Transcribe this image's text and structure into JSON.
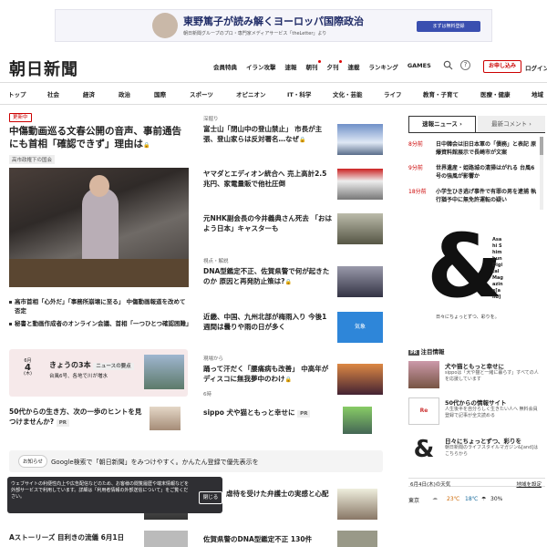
{
  "ad_top": {
    "title": "東野篤子が読み解くヨーロッパ国際政治",
    "sub": "朝日新聞グループのプロ・専門家メディアサービス「theLetter」より",
    "button": "まずは無料登録"
  },
  "header": {
    "logo": "朝日新聞",
    "nav": [
      "会員特典",
      "イラン攻撃",
      "速報",
      "朝刊",
      "夕刊",
      "連載",
      "ランキング",
      "GAMES"
    ],
    "search_icon": "search-icon",
    "help_icon": "help-icon",
    "subscribe": "お申し込み",
    "login": "ログイン"
  },
  "categories": [
    "トップ",
    "社会",
    "経済",
    "政治",
    "国際",
    "スポーツ",
    "オピニオン",
    "IT・科学",
    "文化・芸能",
    "ライフ",
    "教育・子育て",
    "医療・健康",
    "地域"
  ],
  "lead": {
    "badge": "更新中",
    "title": "中傷動画巡る文春公開の音声、事前通告にも首相「確認できず」理由は",
    "tag": "高市政権下の国会",
    "bullets": [
      "高市首相「心外だ」「事務所崩壊に至る」 中傷動画報道を改めて否定",
      "秘書と動画作成者のオンライン会議、首相「一つひとつ確認困難」"
    ]
  },
  "mid_articles": [
    {
      "label": "深掘り",
      "title": "富士山「閉山中の登山禁止」 市長が主張、登山家らは反対署名…なぜ"
    },
    {
      "label": "",
      "title": "ヤマダとエディオン統合へ 売上高計2.5兆円、家電量販で他社圧倒"
    },
    {
      "label": "",
      "title": "元NHK副会長の今井義典さん死去 「おはよう日本」キャスターも"
    },
    {
      "label": "視点・解説",
      "title": "DNA型鑑定不正、佐賀県警で何が起きたのか 原因と再発防止策は?"
    },
    {
      "label": "",
      "title": "近畿、中国、九州北部が梅雨入り 今後1週間は曇りや雨の日が多く"
    },
    {
      "label": "現場から",
      "title": "踊って汗だく「腰痛病も改善」 中高年がディスコに無我夢中のわけ"
    },
    {
      "label": "",
      "title": "sippo 犬や猫ともっと幸せに"
    }
  ],
  "mid_meta": {
    "weather_thumb": "気象",
    "video_count": "PR",
    "hours": "6時"
  },
  "box3": {
    "month": "6月",
    "day": "4",
    "weekday": "(木)",
    "title": "きょうの3本",
    "badge": "ニュースの要点",
    "sub": "台風6号、各地で川が増水"
  },
  "life_item": {
    "title": "50代からの生き方、次の一歩のヒントを見つけませんか?",
    "pr": "PR"
  },
  "notice": {
    "label": "お知らせ",
    "message": "Google検索で「朝日新聞」をみつけやすく。かんたん登録で優先表示を"
  },
  "cookie": {
    "text": "ウェブサイトの利便性向上や広告配信などのため、お客様の閲覧履歴や端末情報などを外部サービスで利用しています。詳細は「利用者情報の外部送信について」をご覧ください。",
    "close": "閉じる"
  },
  "bottom": [
    {
      "title": "Aストーリーズ 目利きの流儀 6月1日"
    },
    {
      "title": "佐賀県警のDNA型鑑定不正 130件"
    },
    {
      "title": "虐待を受けた弁護士の実感と心配"
    }
  ],
  "sidebar": {
    "tab_active": "速報ニュース",
    "tab_inactive": "最新コメント",
    "news": [
      {
        "time": "8分前",
        "text": "日中韓会は旧日本軍の「債務」と表記 原爆資料館展示で長崎市が文案"
      },
      {
        "time": "9分前",
        "text": "世界遺産・姫路城の清掃はがれる 台風6号の強風が影響か"
      },
      {
        "time": "18分前",
        "text": "小学生ひき逃げ事件で有罪の男を逮捕 執行猶予中に無免許運転の疑い"
      }
    ],
    "amp_ad": {
      "brand": "Asahi Shimbun Digital Magazine[and]",
      "tagline": "日々にちょっとずつ、彩りを。"
    },
    "promo_header": "注目情報",
    "promos": [
      {
        "title": "犬や猫ともっと幸せに",
        "desc": "sippoは「犬や猫と一緒に暮らす」すべての人を応援しています"
      },
      {
        "title": "50代からの情報サイト",
        "desc": "人生後半を自分らしく生きたい人へ 無料会員登録で記事が全文読める"
      },
      {
        "title": "日々にちょっとずつ、彩りを",
        "desc": "朝日新聞のライフスタイルマガジン&[and]はこちらから"
      }
    ],
    "weather_head": "6月4日(木)の天気",
    "weather_link": "地域を設定",
    "weather": {
      "city": "東京",
      "high": "23℃",
      "low": "18℃",
      "rain": "30%"
    }
  },
  "colors": {
    "accent": "#cc0000",
    "brand_blue": "#3a4fb0"
  }
}
